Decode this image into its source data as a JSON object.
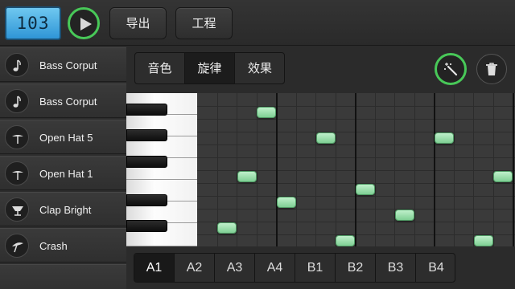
{
  "topbar": {
    "bpm": "103",
    "export_label": "导出",
    "project_label": "工程"
  },
  "tracks": [
    {
      "label": "Bass Corput",
      "icon": "note-icon"
    },
    {
      "label": "Bass Corput",
      "icon": "note-icon"
    },
    {
      "label": "Open Hat 5",
      "icon": "hihat-icon"
    },
    {
      "label": "Open Hat 1",
      "icon": "hihat-icon"
    },
    {
      "label": "Clap Bright",
      "icon": "clap-icon"
    },
    {
      "label": "Crash",
      "icon": "crash-cymbal-icon"
    }
  ],
  "editor_tabs": [
    {
      "label": "音色",
      "active": false
    },
    {
      "label": "旋律",
      "active": true
    },
    {
      "label": "效果",
      "active": false
    }
  ],
  "patterns": [
    {
      "label": "A1",
      "active": true
    },
    {
      "label": "A2",
      "active": false
    },
    {
      "label": "A3",
      "active": false
    },
    {
      "label": "A4",
      "active": false
    },
    {
      "label": "B1",
      "active": false
    },
    {
      "label": "B2",
      "active": false
    },
    {
      "label": "B3",
      "active": false
    },
    {
      "label": "B4",
      "active": false
    }
  ],
  "notes": [
    {
      "step": 1,
      "row": 10
    },
    {
      "step": 2,
      "row": 6
    },
    {
      "step": 3,
      "row": 1
    },
    {
      "step": 4,
      "row": 8
    },
    {
      "step": 6,
      "row": 3
    },
    {
      "step": 7,
      "row": 11
    },
    {
      "step": 8,
      "row": 7
    },
    {
      "step": 10,
      "row": 9
    },
    {
      "step": 12,
      "row": 3
    },
    {
      "step": 14,
      "row": 11
    },
    {
      "step": 15,
      "row": 6
    }
  ],
  "colors": {
    "accent_green": "#48c858",
    "note_green": "#9fe0b0",
    "bpm_blue": "#4fb0e6"
  }
}
